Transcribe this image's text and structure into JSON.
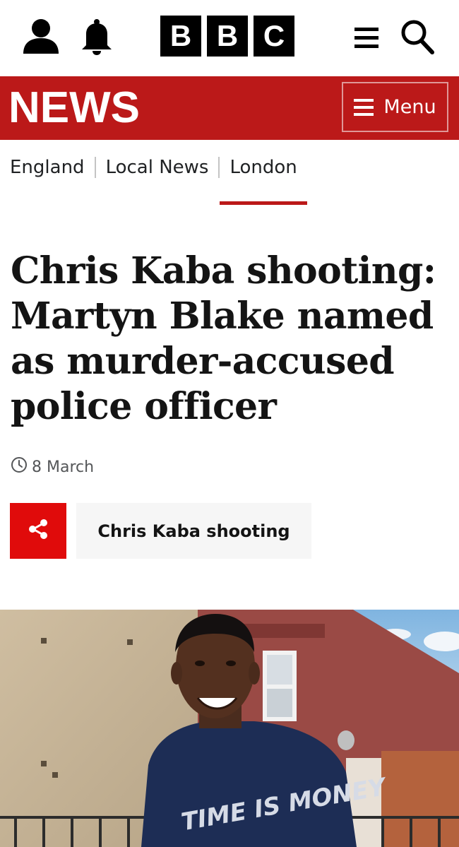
{
  "header": {
    "logo_letters": [
      "B",
      "B",
      "C"
    ],
    "icons": {
      "account": "account-icon",
      "notifications": "bell-icon",
      "more": "more-lines-icon",
      "search": "search-icon"
    }
  },
  "newsbar": {
    "title": "NEWS",
    "menu_label": "Menu",
    "color": "#bb1919"
  },
  "breadcrumb": {
    "items": [
      {
        "label": "England",
        "active": false
      },
      {
        "label": "Local News",
        "active": false
      },
      {
        "label": "London",
        "active": true
      }
    ]
  },
  "article": {
    "headline": "Chris Kaba shooting: Martyn Blake named as murder-accused police officer",
    "date": "8 March",
    "share_color": "#e00b0b",
    "topic_tag": "Chris Kaba shooting",
    "image_slogan": "TIME IS MONEY"
  }
}
